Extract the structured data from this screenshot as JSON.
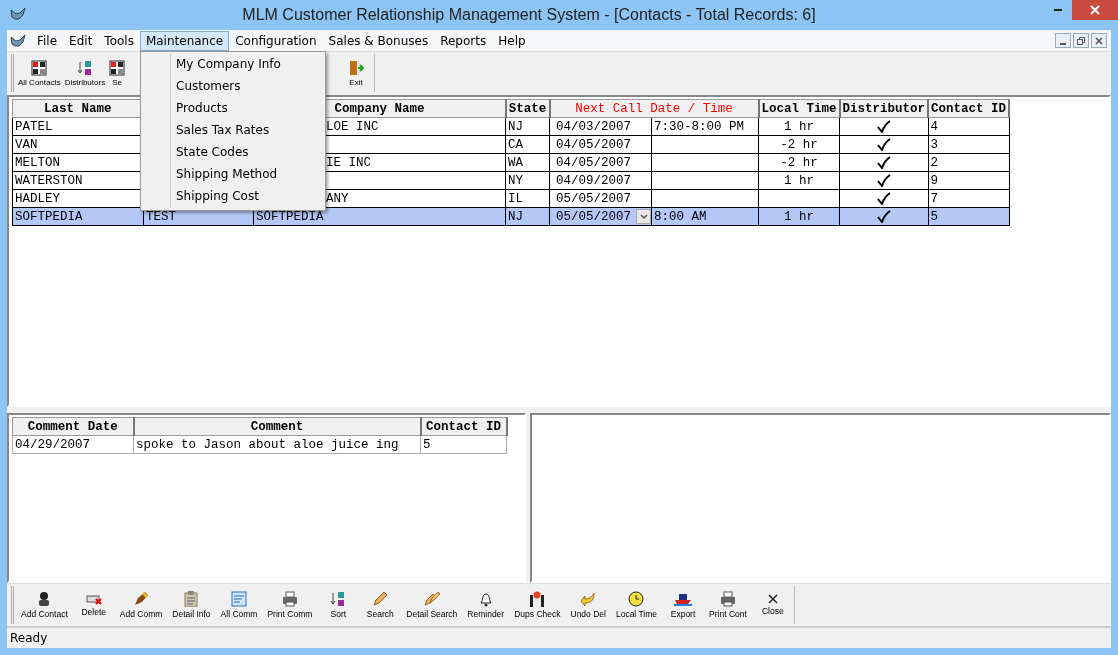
{
  "window": {
    "title": "MLM Customer Relationship Management System - [Contacts - Total Records: 6]"
  },
  "menu_bar": [
    {
      "label": "File",
      "selected": false
    },
    {
      "label": "Edit",
      "selected": false
    },
    {
      "label": "Tools",
      "selected": false
    },
    {
      "label": "Maintenance",
      "selected": true
    },
    {
      "label": "Configuration",
      "selected": false
    },
    {
      "label": "Sales & Bonuses",
      "selected": false
    },
    {
      "label": "Reports",
      "selected": false
    },
    {
      "label": "Help",
      "selected": false
    }
  ],
  "open_menu": {
    "items": [
      "My Company Info",
      "Customers",
      "Products",
      "Sales Tax Rates",
      "State Codes",
      "Shipping Method",
      "Shipping Cost"
    ]
  },
  "toolbar": [
    "All Contacts",
    "Distributors",
    "Se",
    "Exit"
  ],
  "contacts_table": {
    "columns": [
      "Last Name",
      "Company Name",
      "State",
      "Next Call Date / Time",
      "Local Time",
      "Distributor",
      "Contact ID"
    ],
    "rows": [
      {
        "last_name": "PATEL",
        "company": "LOE INC",
        "state": "NJ",
        "date": "04/03/2007",
        "time": "7:30-8:00 PM",
        "local_time": "1 hr",
        "distributor": true,
        "contact_id": "4",
        "selected": false
      },
      {
        "last_name": "VAN",
        "state": "CA",
        "date": "04/05/2007",
        "local_time": "-2 hr",
        "distributor": true,
        "contact_id": "3",
        "selected": false
      },
      {
        "last_name": "MELTON",
        "company": "IE INC",
        "state": "WA",
        "date": "04/05/2007",
        "local_time": "-2 hr",
        "distributor": true,
        "contact_id": "2",
        "selected": false
      },
      {
        "last_name": "WATERSTON",
        "state": "NY",
        "date": "04/09/2007",
        "local_time": "1 hr",
        "distributor": true,
        "contact_id": "9",
        "selected": false
      },
      {
        "last_name": "HADLEY",
        "company": "ANY",
        "state": "IL",
        "date": "05/05/2007",
        "distributor": true,
        "contact_id": "7",
        "selected": false
      },
      {
        "last_name": "SOFTPEDIA",
        "first_name": "TEST",
        "company": "SOFTPEDIA",
        "state": "NJ",
        "date": "05/05/2007",
        "time": "8:00 AM",
        "local_time": "1 hr",
        "distributor": true,
        "contact_id": "5",
        "selected": true
      }
    ]
  },
  "comments_table": {
    "columns": [
      "Comment Date",
      "Comment",
      "Contact ID"
    ],
    "rows": [
      {
        "date": "04/29/2007",
        "comment": "spoke to Jason about aloe juice ing",
        "contact_id": "5"
      }
    ]
  },
  "bottom_toolbar": [
    "Add Contact",
    "Delete",
    "Add Comm",
    "Detail Info",
    "All Comm",
    "Print Comm",
    "Sort",
    "Search",
    "Detail Search",
    "Reminder",
    "Dups Check",
    "Undo Del",
    "Local Time",
    "Export",
    "Print Cont",
    "Close"
  ],
  "status_bar": "Ready"
}
